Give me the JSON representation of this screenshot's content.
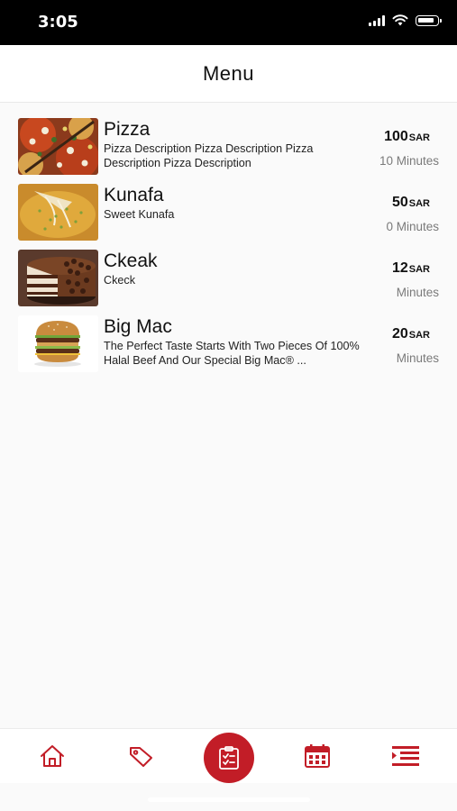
{
  "status_bar": {
    "time": "3:05"
  },
  "header": {
    "title": "Menu"
  },
  "menu": {
    "items": [
      {
        "name": "Pizza",
        "description": "Pizza Description Pizza Description Pizza Description Pizza Description",
        "price": "100",
        "currency": "SAR",
        "time": "10 Minutes"
      },
      {
        "name": "Kunafa",
        "description": "Sweet Kunafa",
        "price": "50",
        "currency": "SAR",
        "time": "0 Minutes"
      },
      {
        "name": "Ckeak",
        "description": "Ckeck",
        "price": "12",
        "currency": "SAR",
        "time": "Minutes"
      },
      {
        "name": "Big Mac",
        "description": "The Perfect Taste Starts With Two Pieces Of 100% Halal Beef And Our Special Big Mac® ...",
        "price": "20",
        "currency": "SAR",
        "time": "Minutes"
      }
    ]
  },
  "bottom_nav": {
    "items": [
      {
        "icon": "home-icon"
      },
      {
        "icon": "tag-icon"
      },
      {
        "icon": "clipboard-icon",
        "active": true
      },
      {
        "icon": "calendar-icon"
      },
      {
        "icon": "menu-list-icon"
      }
    ]
  },
  "colors": {
    "accent": "#c21d27",
    "background": "#fafafa"
  }
}
